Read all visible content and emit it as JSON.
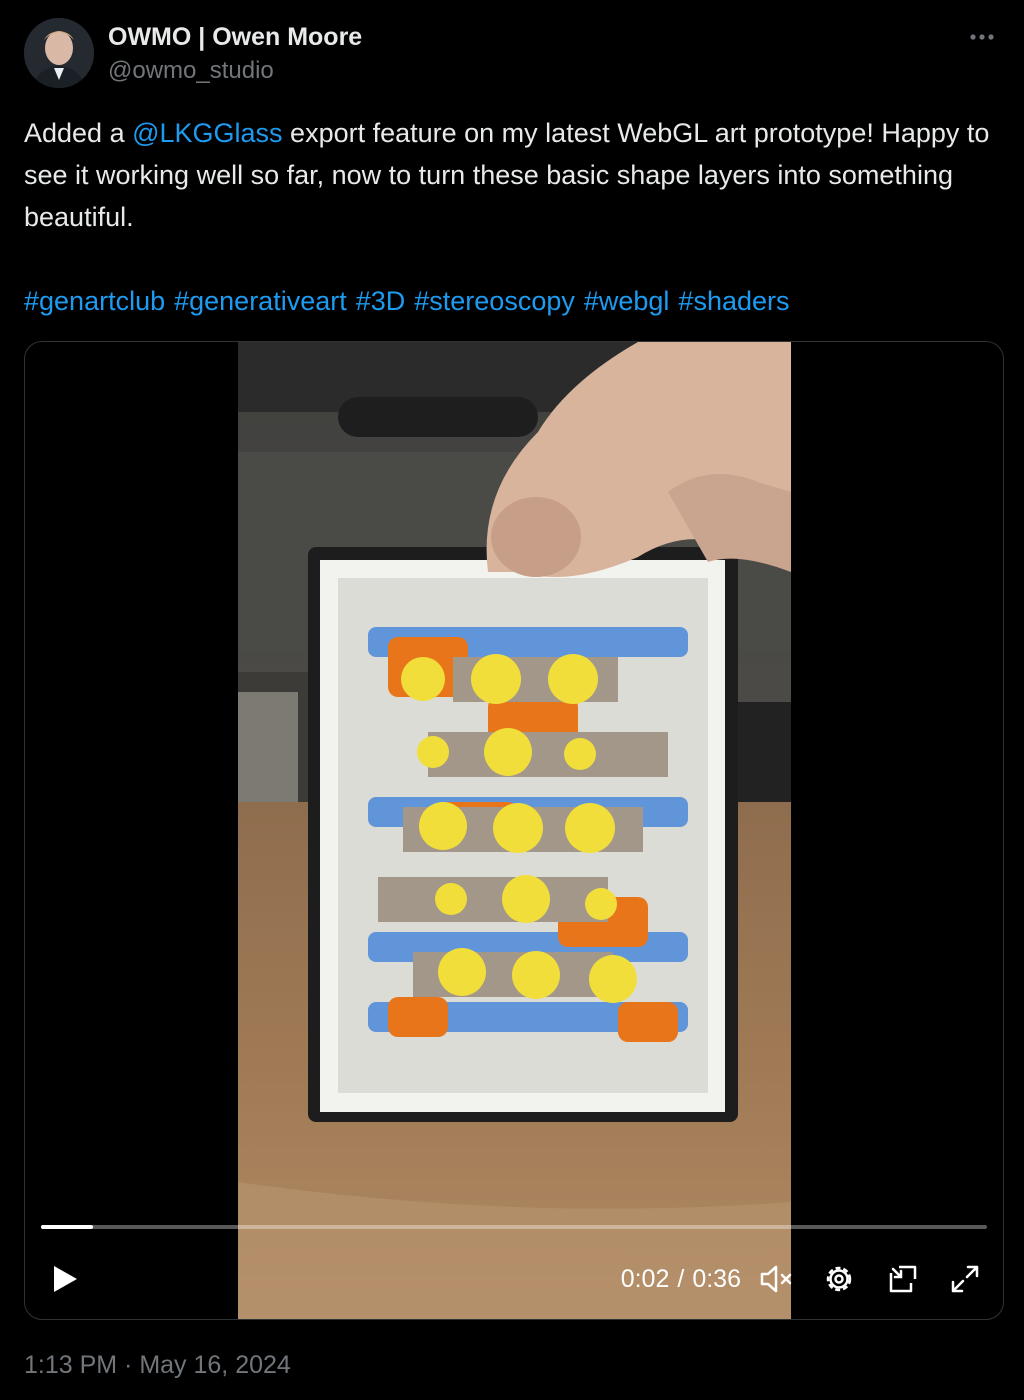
{
  "author": {
    "display_name": "OWMO | Owen Moore",
    "handle": "@owmo_studio"
  },
  "tweet": {
    "text_before_mention": "Added a ",
    "mention": "@LKGGlass",
    "text_after_mention": " export feature on my latest WebGL art prototype! Happy to see it working well so far, now to turn these basic shape layers into something beautiful.",
    "hashtags": [
      "#genartclub",
      "#generativeart",
      "#3D",
      "#stereoscopy",
      "#webgl",
      "#shaders"
    ]
  },
  "video": {
    "current_time": "0:02",
    "separator": "/",
    "duration": "0:36",
    "progress_fraction": 0.055,
    "muted": true
  },
  "timestamp": "1:13 PM · May 16, 2024",
  "colors": {
    "background": "#000000",
    "text": "#e7e9ea",
    "secondary": "#71767b",
    "link": "#1d9bf0",
    "border": "#2f3336"
  },
  "icons": [
    "more-icon",
    "play-icon",
    "volume-muted-icon",
    "settings-icon",
    "picture-in-picture-icon",
    "fullscreen-icon"
  ]
}
